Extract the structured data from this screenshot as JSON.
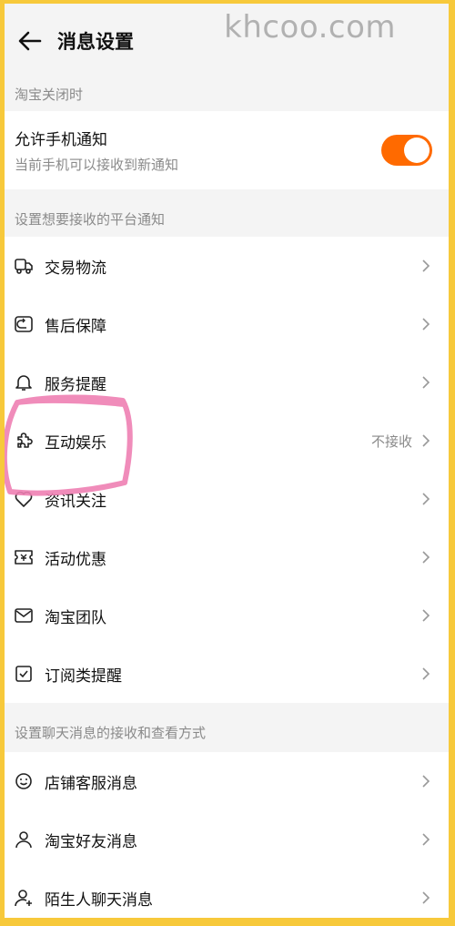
{
  "watermark": "khcoo.com",
  "header": {
    "title": "消息设置"
  },
  "section_closed": {
    "title": "淘宝关闭时",
    "toggle": {
      "title": "允许手机通知",
      "subtitle": "当前手机可以接收到新通知",
      "on": true,
      "accent": "#ff6a00"
    }
  },
  "section_platform": {
    "title": "设置想要接收的平台通知",
    "items": [
      {
        "label": "交易物流",
        "status": "",
        "icon": "truck-icon"
      },
      {
        "label": "售后保障",
        "status": "",
        "icon": "refund-icon"
      },
      {
        "label": "服务提醒",
        "status": "",
        "icon": "bell-icon"
      },
      {
        "label": "互动娱乐",
        "status": "不接收",
        "icon": "puzzle-icon"
      },
      {
        "label": "资讯关注",
        "status": "",
        "icon": "heart-icon"
      },
      {
        "label": "活动优惠",
        "status": "",
        "icon": "ticket-icon"
      },
      {
        "label": "淘宝团队",
        "status": "",
        "icon": "mail-icon"
      },
      {
        "label": "订阅类提醒",
        "status": "",
        "icon": "checkbox-icon"
      }
    ]
  },
  "section_chat": {
    "title": "设置聊天消息的接收和查看方式",
    "items": [
      {
        "label": "店铺客服消息",
        "icon": "smile-icon"
      },
      {
        "label": "淘宝好友消息",
        "icon": "user-icon"
      },
      {
        "label": "陌生人聊天消息",
        "icon": "user-plus-icon"
      }
    ]
  }
}
